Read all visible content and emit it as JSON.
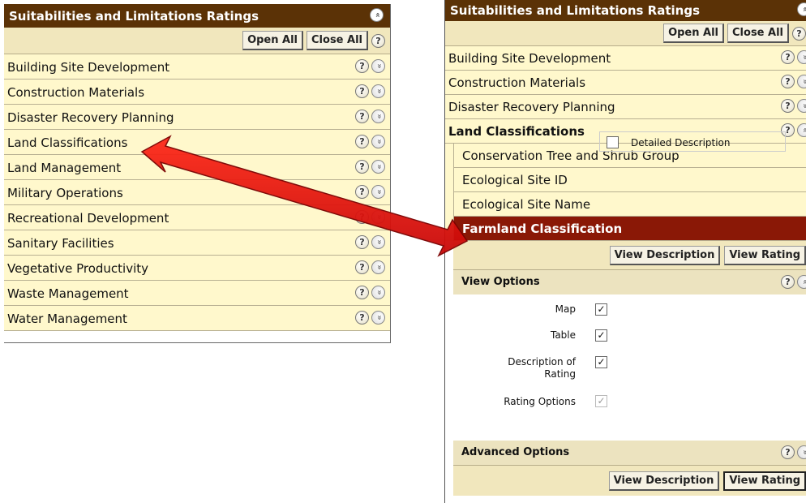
{
  "left": {
    "title": "Suitabilities and Limitations Ratings",
    "open_all": "Open All",
    "close_all": "Close All",
    "items": [
      {
        "label": "Building Site Development"
      },
      {
        "label": "Construction Materials"
      },
      {
        "label": "Disaster Recovery Planning"
      },
      {
        "label": "Land Classifications"
      },
      {
        "label": "Land Management"
      },
      {
        "label": "Military Operations"
      },
      {
        "label": "Recreational Development"
      },
      {
        "label": "Sanitary Facilities"
      },
      {
        "label": "Vegetative Productivity"
      },
      {
        "label": "Waste Management"
      },
      {
        "label": "Water Management"
      }
    ]
  },
  "right": {
    "title": "Suitabilities and Limitations Ratings",
    "open_all": "Open All",
    "close_all": "Close All",
    "items": [
      {
        "label": "Building Site Development"
      },
      {
        "label": "Construction Materials"
      },
      {
        "label": "Disaster Recovery Planning"
      },
      {
        "label": "Land Classifications"
      }
    ],
    "sub_items": [
      {
        "label": "Conservation Tree and Shrub Group"
      },
      {
        "label": "Ecological Site ID"
      },
      {
        "label": "Ecological Site Name"
      },
      {
        "label": "Farmland Classification"
      }
    ],
    "view_description": "View Description",
    "view_rating": "View Rating",
    "view_options": {
      "heading": "View Options",
      "map": "Map",
      "table": "Table",
      "description_line1": "Description of",
      "description_line2": "Rating",
      "rating_options": "Rating Options",
      "detailed_description": "Detailed Description"
    },
    "advanced_options": "Advanced Options"
  },
  "glyphs": {
    "help": "?",
    "expand": "»",
    "collapse": "«",
    "check": "✓"
  },
  "colors": {
    "title_bar": "#5b3206",
    "row_bg": "#fff8cc",
    "selected_bg": "#8a1806",
    "arrow": "#e01010"
  }
}
